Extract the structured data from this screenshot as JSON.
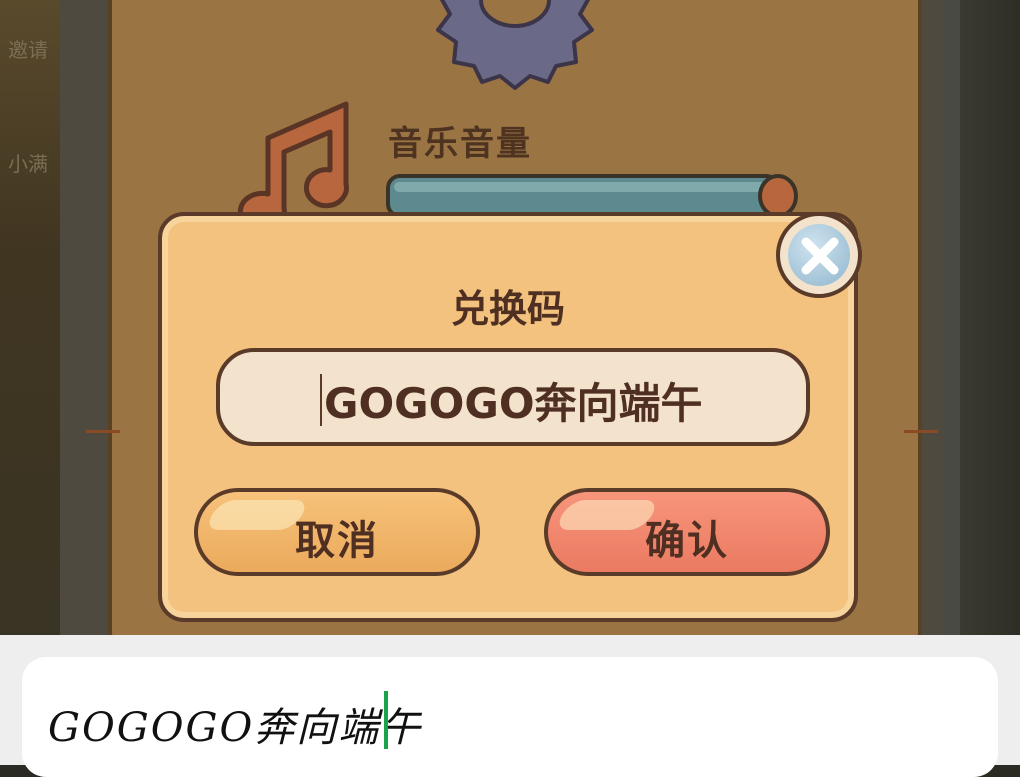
{
  "background": {
    "left_texts": [
      "邀请",
      "小满"
    ]
  },
  "settings": {
    "music_label": "音乐音量"
  },
  "dialog": {
    "title": "兑换码",
    "code_value": "GOGOGO奔向端午",
    "cancel_label": "取消",
    "confirm_label": "确认"
  },
  "keyboard_input": {
    "text": "GOGOGO奔向端午"
  },
  "icons": {
    "gear": "gear-icon",
    "music": "music-note-icon",
    "close": "close-icon"
  },
  "colors": {
    "dialog_bg": "#f2c27e",
    "cancel": "#ebaa5c",
    "confirm": "#eb7a62",
    "caret": "#1aa34a"
  }
}
